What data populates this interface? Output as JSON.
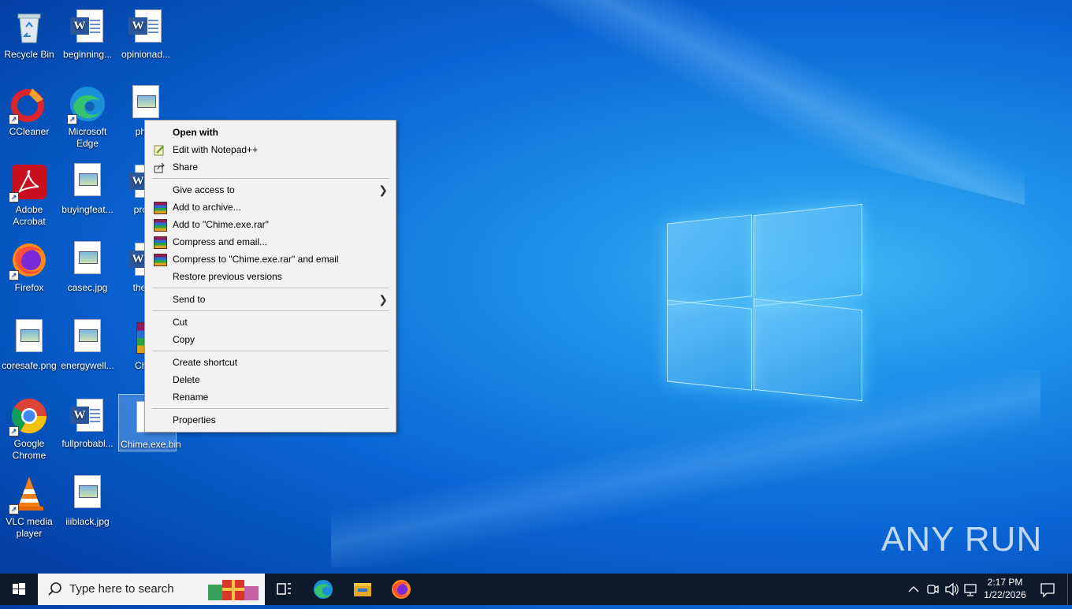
{
  "desktop": {
    "icons": [
      {
        "label": "Recycle Bin"
      },
      {
        "label": "beginning..."
      },
      {
        "label": "opinionad..."
      },
      {
        "label": "CCleaner"
      },
      {
        "label": "Microsoft Edge"
      },
      {
        "label": "phpn"
      },
      {
        "label": "Adobe Acrobat"
      },
      {
        "label": "buyingfeat..."
      },
      {
        "label": "produ"
      },
      {
        "label": "Firefox"
      },
      {
        "label": "casec.jpg"
      },
      {
        "label": "thems"
      },
      {
        "label": "coresafe.png"
      },
      {
        "label": "energywell..."
      },
      {
        "label": "Chim"
      },
      {
        "label": "Google Chrome"
      },
      {
        "label": "fullprobabl..."
      },
      {
        "label": "Chime.exe.bin"
      },
      {
        "label": "VLC media player"
      },
      {
        "label": "iiiblack.jpg"
      }
    ],
    "watermark": "ANY RUN"
  },
  "context_menu": {
    "items": [
      {
        "label": "Open with"
      },
      {
        "label": "Edit with Notepad++"
      },
      {
        "label": "Share"
      },
      {
        "label": "Give access to"
      },
      {
        "label": "Add to archive..."
      },
      {
        "label": "Add to \"Chime.exe.rar\""
      },
      {
        "label": "Compress and email..."
      },
      {
        "label": "Compress to \"Chime.exe.rar\" and email"
      },
      {
        "label": "Restore previous versions"
      },
      {
        "label": "Send to"
      },
      {
        "label": "Cut"
      },
      {
        "label": "Copy"
      },
      {
        "label": "Create shortcut"
      },
      {
        "label": "Delete"
      },
      {
        "label": "Rename"
      },
      {
        "label": "Properties"
      }
    ]
  },
  "taskbar": {
    "search_placeholder": "Type here to search",
    "time": "2:17 PM",
    "date": "1/22/2026"
  },
  "colors": {
    "taskbar": "#0c1a2c",
    "menu_bg": "#f2f2f2",
    "desktop_accent": "#0a66d6"
  }
}
